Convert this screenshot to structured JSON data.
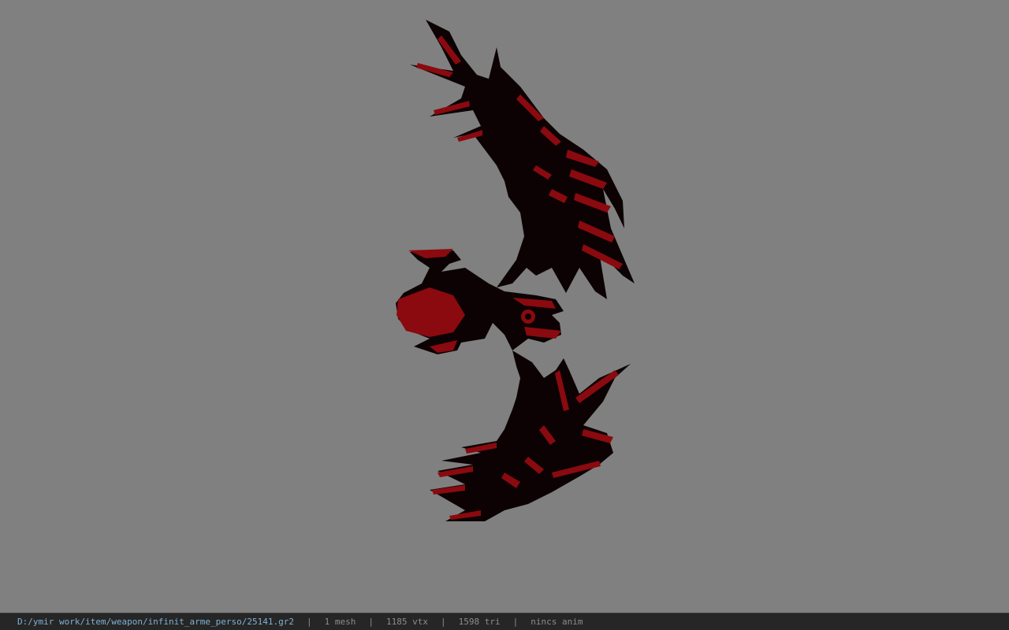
{
  "viewport": {
    "background": "#808080",
    "model": {
      "name": "",
      "base_color": "#0c0203",
      "accent_color": "#8a0a0f"
    }
  },
  "statusbar": {
    "file_path": "D:/ymir work/item/weapon/infinit_arme_perso/25141.gr2",
    "separator": "|",
    "mesh_count": "1 mesh",
    "vertex_count": "1185 vtx",
    "triangle_count": "1598 tri",
    "anim_status": "nincs anim",
    "path_color": "#7fb2d6",
    "text_color": "#8d8d8d",
    "background": "#262626"
  }
}
